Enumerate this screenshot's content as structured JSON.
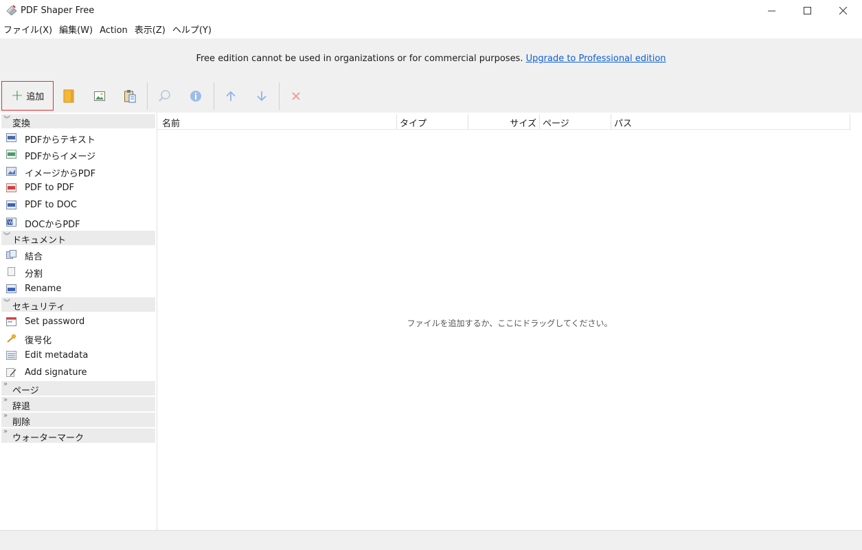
{
  "window": {
    "title": "PDF Shaper Free",
    "controls": [
      "minimize-icon",
      "maximize-icon",
      "close-icon"
    ]
  },
  "menu": [
    "ファイル(X)",
    "編集(W)",
    "Action",
    "表示(Z)",
    "ヘルプ(Y)"
  ],
  "notice": {
    "text": "Free edition cannot be used in organizations or for commercial purposes.",
    "link": "Upgrade to Professional edition"
  },
  "toolbar": {
    "add_label": "追加",
    "icons": [
      "add-plus-icon",
      "open-file-icon",
      "add-image-icon",
      "paste-icon",
      "search-icon",
      "info-icon",
      "move-up-icon",
      "move-down-icon",
      "remove-icon"
    ]
  },
  "sidebar": {
    "groups": [
      {
        "label": "変換",
        "expanded": true,
        "items": [
          {
            "label": "PDFからテキスト",
            "icon": "txt-icon"
          },
          {
            "label": "PDFからイメージ",
            "icon": "jpg-icon"
          },
          {
            "label": "イメージからPDF",
            "icon": "image-to-pdf-icon"
          },
          {
            "label": "PDF to PDF",
            "icon": "pdf-icon"
          },
          {
            "label": "PDF to DOC",
            "icon": "doc-icon"
          },
          {
            "label": "DOCからPDF",
            "icon": "word-icon"
          }
        ]
      },
      {
        "label": "ドキュメント",
        "expanded": true,
        "items": [
          {
            "label": "結合",
            "icon": "merge-icon"
          },
          {
            "label": "分割",
            "icon": "split-icon"
          },
          {
            "label": "Rename",
            "icon": "rename-icon"
          }
        ]
      },
      {
        "label": "セキュリティ",
        "expanded": true,
        "items": [
          {
            "label": "Set password",
            "icon": "password-icon"
          },
          {
            "label": "復号化",
            "icon": "key-icon"
          },
          {
            "label": "Edit metadata",
            "icon": "metadata-icon"
          },
          {
            "label": "Add signature",
            "icon": "signature-icon"
          }
        ]
      },
      {
        "label": "ページ",
        "expanded": false,
        "items": []
      },
      {
        "label": "辞退",
        "expanded": false,
        "items": []
      },
      {
        "label": "削除",
        "expanded": false,
        "items": []
      },
      {
        "label": "ウォーターマーク",
        "expanded": false,
        "items": []
      }
    ]
  },
  "file_list": {
    "columns": [
      "名前",
      "タイプ",
      "サイズ",
      "ページ",
      "パス"
    ],
    "empty_message": "ファイルを追加するか、ここにドラッグしてください。"
  },
  "colors": {
    "link": "#0b5ed7",
    "add_highlight_border": "#e03030",
    "plus_green": "#3a9a4a",
    "arrow_blue": "#4a8fe0",
    "remove_red": "#e05050"
  }
}
